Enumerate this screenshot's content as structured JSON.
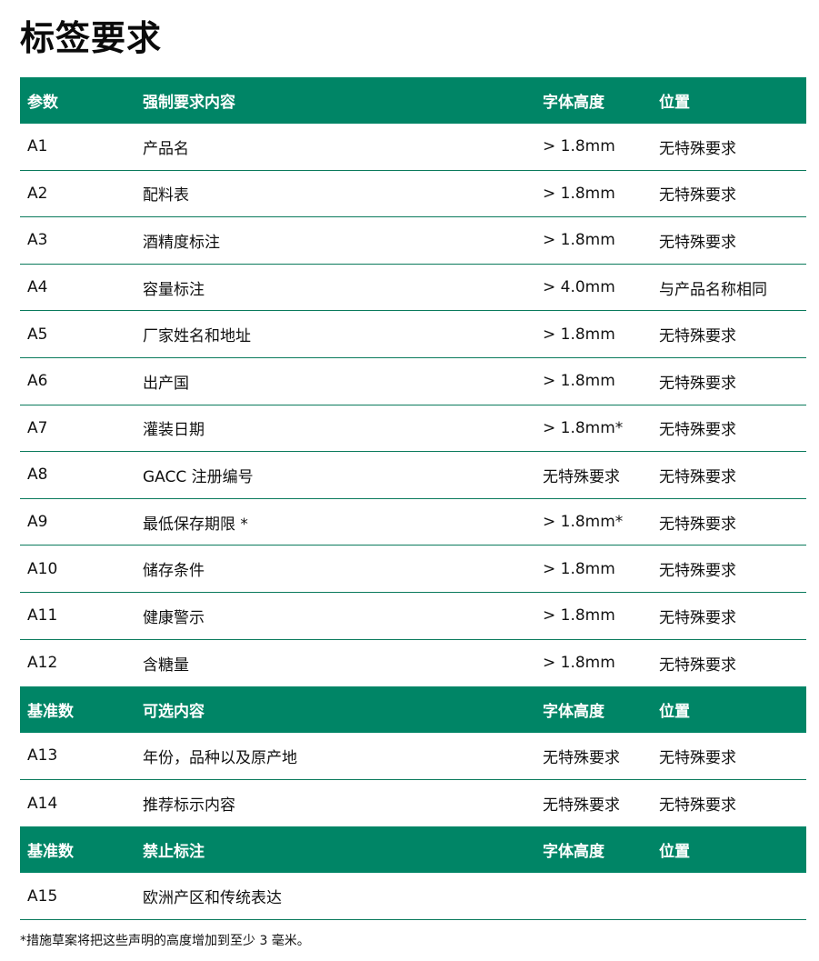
{
  "title": "标签要求",
  "sections": [
    {
      "header": [
        "参数",
        "强制要求内容",
        "字体高度",
        "位置"
      ],
      "rows": [
        [
          "A1",
          "产品名",
          "> 1.8mm",
          "无特殊要求"
        ],
        [
          "A2",
          "配料表",
          "> 1.8mm",
          "无特殊要求"
        ],
        [
          "A3",
          "酒精度标注",
          "> 1.8mm",
          "无特殊要求"
        ],
        [
          "A4",
          "容量标注",
          "> 4.0mm",
          "与产品名称相同"
        ],
        [
          "A5",
          "厂家姓名和地址",
          "> 1.8mm",
          "无特殊要求"
        ],
        [
          "A6",
          "出产国",
          "> 1.8mm",
          "无特殊要求"
        ],
        [
          "A7",
          "灌装日期",
          "> 1.8mm*",
          "无特殊要求"
        ],
        [
          "A8",
          "GACC 注册编号",
          "无特殊要求",
          "无特殊要求"
        ],
        [
          "A9",
          "最低保存期限 *",
          "> 1.8mm*",
          "无特殊要求"
        ],
        [
          "A10",
          "储存条件",
          "> 1.8mm",
          "无特殊要求"
        ],
        [
          "A11",
          "健康警示",
          "> 1.8mm",
          "无特殊要求"
        ],
        [
          "A12",
          "含糖量",
          "> 1.8mm",
          "无特殊要求"
        ]
      ]
    },
    {
      "header": [
        "基准数",
        "可选内容",
        "字体高度",
        "位置"
      ],
      "rows": [
        [
          "A13",
          "年份，品种以及原产地",
          "无特殊要求",
          "无特殊要求"
        ],
        [
          "A14",
          "推荐标示内容",
          "无特殊要求",
          "无特殊要求"
        ]
      ]
    },
    {
      "header": [
        "基准数",
        "禁止标注",
        "字体高度",
        "位置"
      ],
      "rows": [
        [
          "A15",
          "欧洲产区和传统表达",
          "",
          ""
        ]
      ]
    }
  ],
  "footnote": "*措施草案将把这些声明的高度增加到至少 3 毫米。"
}
